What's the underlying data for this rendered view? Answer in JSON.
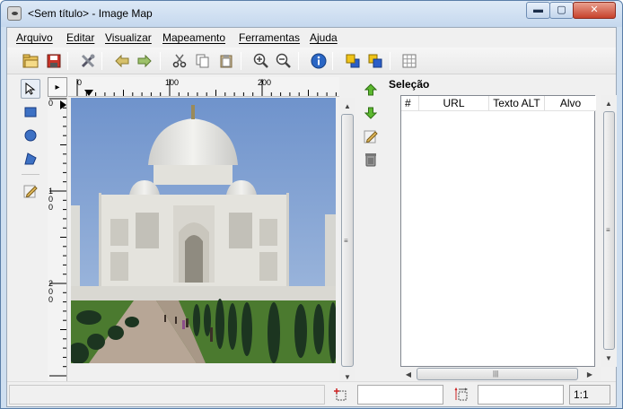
{
  "window": {
    "title": "<Sem título> - Image Map",
    "minimize_label": "▬",
    "maximize_label": "▢",
    "close_label": "✕"
  },
  "menu": {
    "items": [
      "Arquivo",
      "Editar",
      "Visualizar",
      "Mapeamento",
      "Ferramentas",
      "Ajuda"
    ]
  },
  "toolbar": {
    "buttons": [
      "open-icon",
      "save-icon",
      "preferences-icon",
      "undo-icon",
      "redo-icon",
      "cut-icon",
      "copy-icon",
      "paste-icon",
      "zoom-in-icon",
      "zoom-out-icon",
      "info-icon",
      "area-to-front-icon",
      "area-to-back-icon",
      "grid-icon"
    ]
  },
  "tools": {
    "items": [
      "pointer-icon",
      "rectangle-icon",
      "circle-icon",
      "polygon-icon",
      "edit-icon"
    ]
  },
  "rulers": {
    "horizontal": [
      "0",
      "100",
      "200"
    ],
    "vertical": [
      "0",
      "100",
      "200"
    ],
    "corner_label": "▸"
  },
  "selection": {
    "title": "Seleção",
    "columns": [
      "#",
      "URL",
      "Texto ALT",
      "Alvo"
    ],
    "rows": [],
    "buttons": [
      "move-up-icon",
      "move-down-icon",
      "edit-area-icon",
      "delete-icon"
    ]
  },
  "statusbar": {
    "position": "",
    "dimension": "",
    "zoom": "1:1"
  },
  "colors": {
    "sky": "#7d9fd2",
    "marble": "#e6e5e0",
    "lawn": "#4b7a2f",
    "path": "#b7a696",
    "cypress": "#1c3520"
  }
}
